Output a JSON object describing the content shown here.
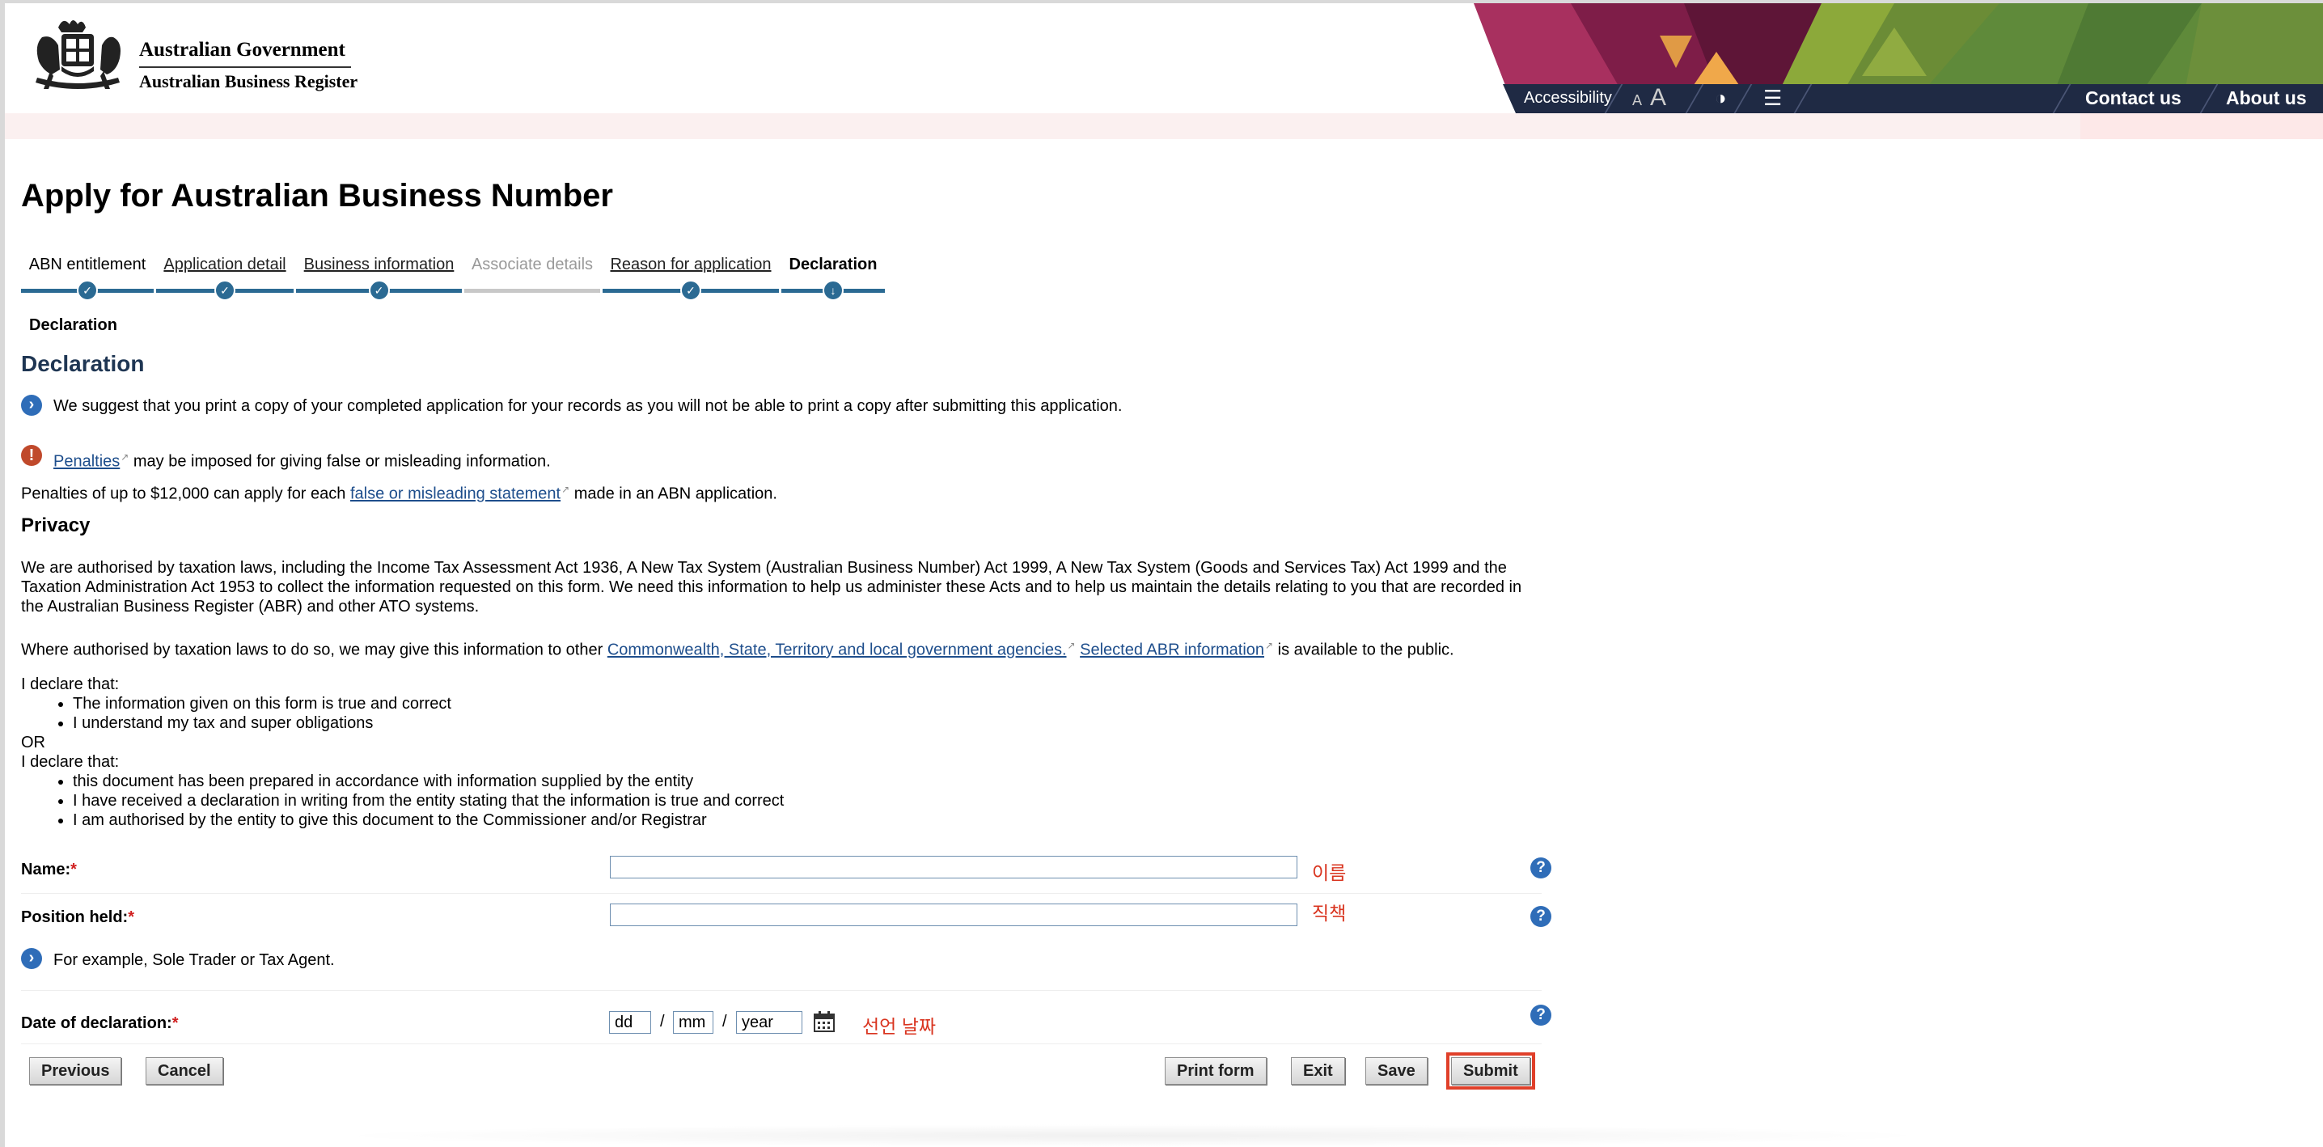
{
  "header": {
    "gov_line1": "Australian Government",
    "gov_line2": "Australian Business Register",
    "accessibility": "Accessibility",
    "font_small": "A",
    "font_large": "A",
    "contact": "Contact us",
    "about": "About us"
  },
  "page": {
    "title": "Apply for Australian Business Number"
  },
  "steps": [
    {
      "label": "ABN entitlement"
    },
    {
      "label": "Application detail"
    },
    {
      "label": "Business information"
    },
    {
      "label": "Associate details"
    },
    {
      "label": "Reason for application"
    },
    {
      "label": "Declaration"
    }
  ],
  "sub_label": "Declaration",
  "declaration": {
    "title": "Declaration",
    "print_note": "We suggest that you print a copy of your completed application for your records as you will not be able to print a copy after submitting this application.",
    "penalties_link": "Penalties",
    "penalties_rest": " may be imposed for giving false or misleading information.",
    "penalties2_pre": "Penalties of up to $12,000 can apply for each ",
    "penalties2_link": "false or misleading statement",
    "penalties2_post": " made in an ABN application."
  },
  "privacy": {
    "title": "Privacy",
    "para1": "We are authorised by taxation laws, including the Income Tax Assessment Act 1936, A New Tax System (Australian Business Number) Act 1999, A New Tax System (Goods and Services Tax) Act 1999 and the Taxation Administration Act 1953 to collect the information requested on this form. We need this information to help us administer these Acts and to help us maintain the details relating to you that are recorded in the Australian Business Register (ABR) and other ATO systems.",
    "para2_pre": "Where authorised by taxation laws to do so, we may give this information to other ",
    "para2_link1": "Commonwealth, State, Territory and local government agencies.",
    "para2_link2": "Selected ABR information",
    "para2_post": " is available to the public."
  },
  "declare": {
    "intro1": "I declare that:",
    "list1": [
      "The information given on this form is true and correct",
      "I understand my tax and super obligations"
    ],
    "or": "OR",
    "intro2": "I declare that:",
    "list2": [
      "this document has been prepared in accordance with information supplied by the entity",
      "I have received a declaration in writing from the entity stating that the information is true and correct",
      "I am authorised by the entity to give this document to the Commissioner and/or Registrar"
    ]
  },
  "form": {
    "name_label": "Name:",
    "name_value": "",
    "name_annot": "이름",
    "position_label": "Position held:",
    "position_value": "",
    "position_annot": "직책",
    "position_hint": "For example, Sole Trader or Tax Agent.",
    "date_label": "Date of declaration:",
    "dd_value": "dd",
    "mm_value": "mm",
    "year_value": "year",
    "date_annot": "선언 날짜",
    "required_mark": "*",
    "help_glyph": "?"
  },
  "buttons": {
    "previous": "Previous",
    "cancel": "Cancel",
    "print": "Print form",
    "exit": "Exit",
    "save": "Save",
    "submit": "Submit"
  },
  "colors": {
    "link": "#1e4e8c",
    "step_bar": "#2b6a93",
    "annotation": "#d9341f",
    "highlight": "#e0402a"
  }
}
